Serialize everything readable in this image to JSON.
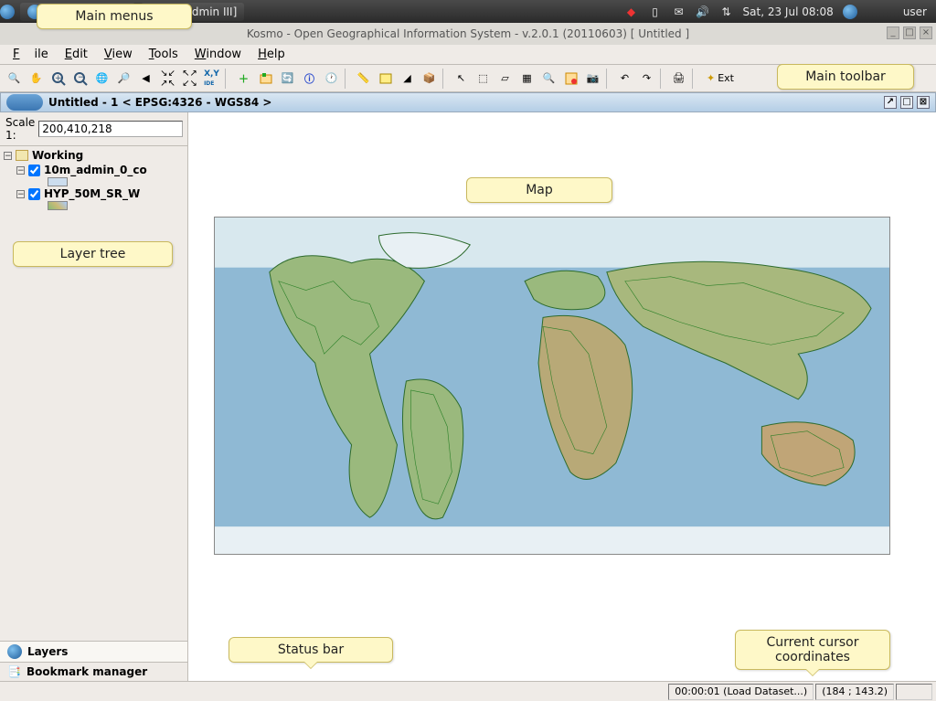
{
  "taskbar": {
    "app1_label": "",
    "app2_label": "[pgAdmin III]",
    "clock": "Sat, 23 Jul  08:08",
    "user": "user"
  },
  "window": {
    "title": "Kosmo - Open Geographical Information System - v.2.0.1 (20110603)  [ Untitled ]"
  },
  "menus": {
    "file": "File",
    "edit": "Edit",
    "view": "View",
    "tools": "Tools",
    "window": "Window",
    "help": "Help"
  },
  "map_frame": {
    "title": "Untitled - 1 < EPSG:4326 - WGS84 >"
  },
  "scale": {
    "label": "Scale 1:",
    "value": "200,410,218"
  },
  "tree": {
    "root": "Working",
    "layer1": "10m_admin_0_co",
    "layer2": "HYP_50M_SR_W"
  },
  "sidebar_tabs": {
    "layers": "Layers",
    "bookmark": "Bookmark manager"
  },
  "status": {
    "load": "00:00:01 (Load Dataset...)",
    "coords": "(184 ; 143.2)"
  },
  "toolbar": {
    "ext": "Ext"
  },
  "callouts": {
    "menus": "Main menus",
    "toolbar": "Main toolbar",
    "map": "Map",
    "tree": "Layer tree",
    "status": "Status bar",
    "coords": "Current cursor\ncoordinates"
  }
}
